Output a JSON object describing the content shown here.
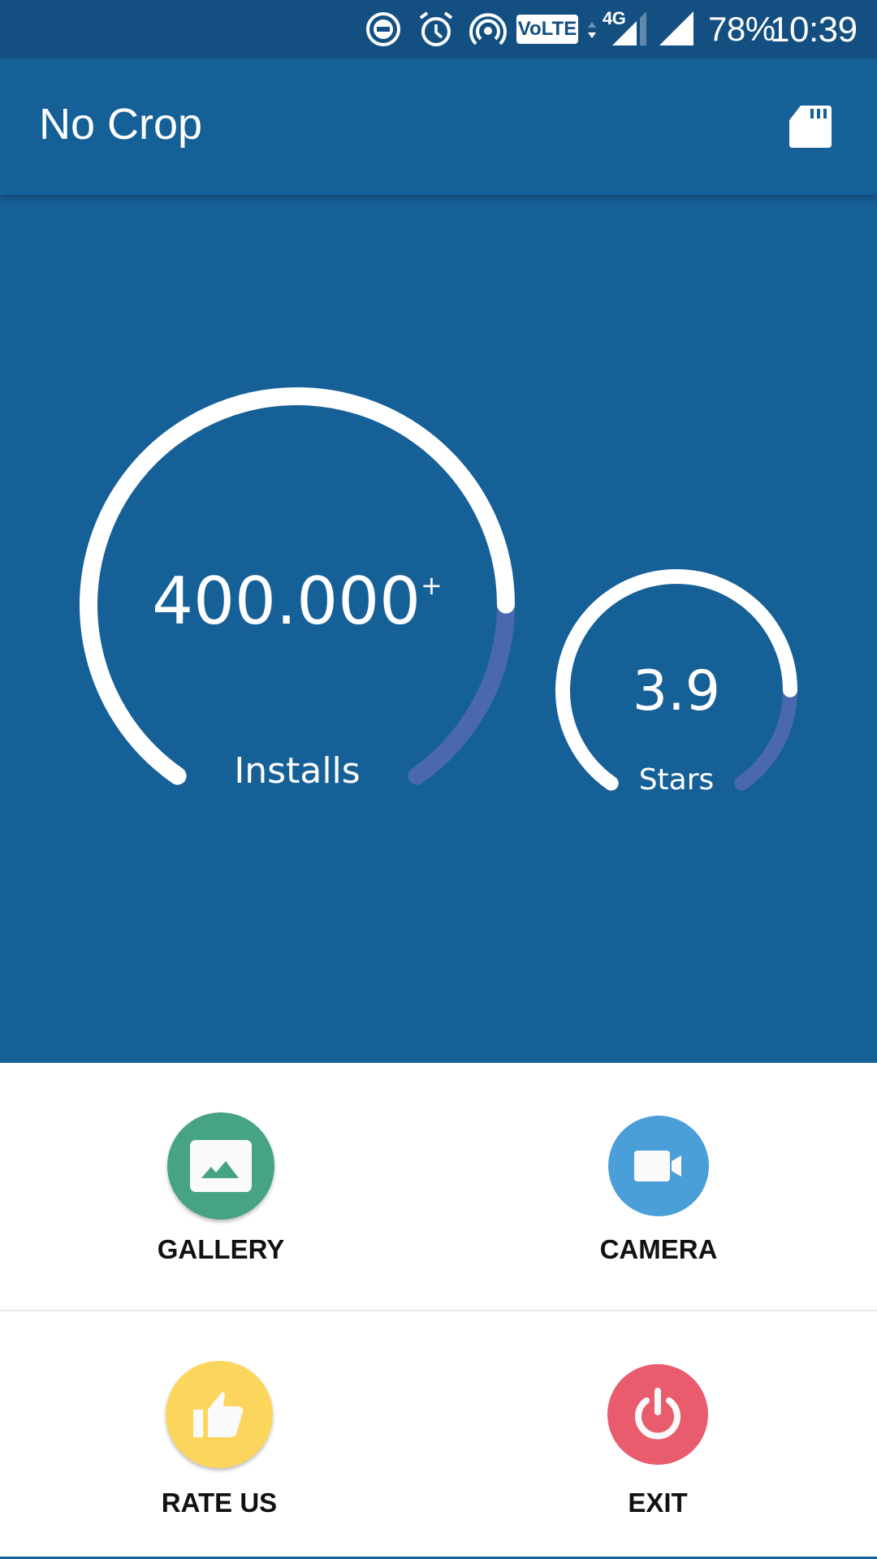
{
  "status_bar": {
    "icons": [
      "do-not-disturb-icon",
      "alarm-icon",
      "hotspot-icon",
      "volte-icon",
      "data-arrows-icon",
      "signal-4g-icon",
      "signal-icon"
    ],
    "volte_label": "VoLTE",
    "network_label": "4G",
    "battery": "78%",
    "time": "10:39"
  },
  "app_bar": {
    "title": "No Crop",
    "action_icon": "sd-card-icon"
  },
  "stats": {
    "installs": {
      "value": "400.000",
      "suffix": "+",
      "label": "Installs",
      "fill_fraction": 0.81
    },
    "stars": {
      "value": "3.9",
      "label": "Stars",
      "fill_fraction": 0.81
    }
  },
  "actions": [
    {
      "label": "GALLERY",
      "icon": "image-icon",
      "color": "#46a386"
    },
    {
      "label": "CAMERA",
      "icon": "videocam-icon",
      "color": "#4a9fd9"
    },
    {
      "label": "RATE US",
      "icon": "thumb-up-icon",
      "color": "#fcd65c"
    },
    {
      "label": "EXIT",
      "icon": "power-icon",
      "color": "#e85c6d"
    }
  ],
  "colors": {
    "primary": "#166098",
    "status_bar": "#134f80",
    "gauge_track": "#ffffff",
    "gauge_remaining": "#4a68b0"
  }
}
